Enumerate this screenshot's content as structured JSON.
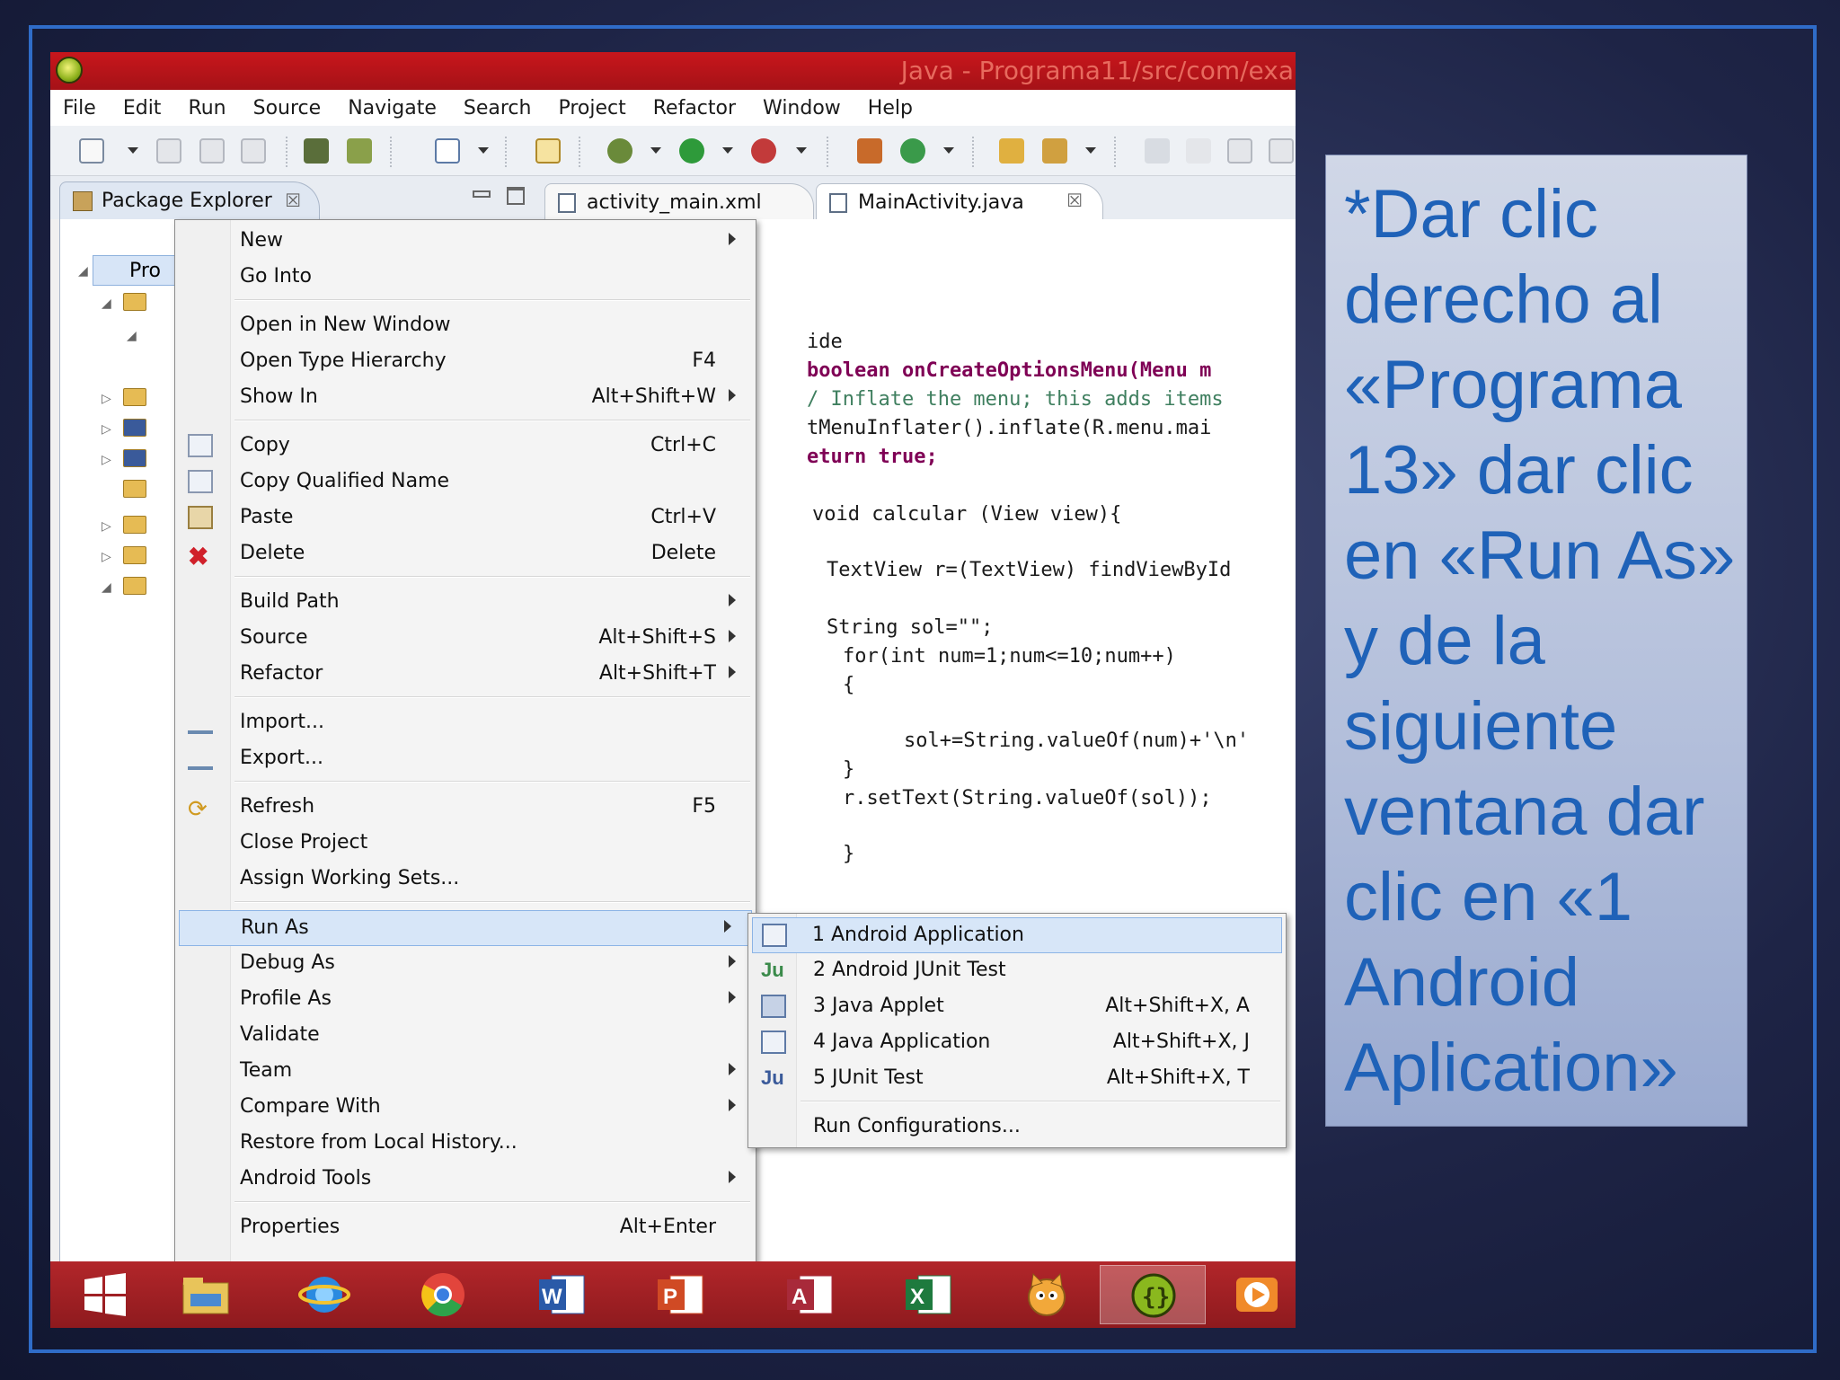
{
  "window": {
    "title": "Java - Programa11/src/com/exa"
  },
  "menubar": [
    "File",
    "Edit",
    "Run",
    "Source",
    "Navigate",
    "Search",
    "Project",
    "Refactor",
    "Window",
    "Help"
  ],
  "views": {
    "package_explorer_label": "Package Explorer",
    "close_glyph": "☒",
    "root_item": "Pro"
  },
  "editor_tabs": [
    {
      "label": "activity_main.xml"
    },
    {
      "label": "MainActivity.java"
    }
  ],
  "code": [
    "ide",
    "boolean onCreateOptionsMenu(Menu m",
    "/ Inflate the menu; this adds items",
    "tMenuInflater().inflate(R.menu.mai",
    "eturn true;",
    "void calcular (View view){",
    "TextView r=(TextView) findViewById",
    "String sol=\"\";",
    "for(int num=1;num<=10;num++)",
    "{",
    "sol+=String.valueOf(num)+'\\n'",
    "}",
    "r.setText(String.valueOf(sol));",
    "}"
  ],
  "context_menu": {
    "new": "New",
    "go_into": "Go Into",
    "open_new_window": "Open in New Window",
    "open_type_hierarchy": "Open Type Hierarchy",
    "open_type_hierarchy_sc": "F4",
    "show_in": "Show In",
    "show_in_sc": "Alt+Shift+W",
    "copy": "Copy",
    "copy_sc": "Ctrl+C",
    "copy_qualified": "Copy Qualified Name",
    "paste": "Paste",
    "paste_sc": "Ctrl+V",
    "delete": "Delete",
    "delete_sc": "Delete",
    "build_path": "Build Path",
    "source": "Source",
    "source_sc": "Alt+Shift+S",
    "refactor": "Refactor",
    "refactor_sc": "Alt+Shift+T",
    "import": "Import...",
    "export": "Export...",
    "refresh": "Refresh",
    "refresh_sc": "F5",
    "close_project": "Close Project",
    "assign_working_sets": "Assign Working Sets...",
    "run_as": "Run As",
    "debug_as": "Debug As",
    "profile_as": "Profile As",
    "validate": "Validate",
    "team": "Team",
    "compare_with": "Compare With",
    "restore_history": "Restore from Local History...",
    "android_tools": "Android Tools",
    "properties": "Properties",
    "properties_sc": "Alt+Enter"
  },
  "run_as_menu": {
    "android_app": "1 Android Application",
    "android_junit": "2 Android JUnit Test",
    "java_applet": "3 Java Applet",
    "java_applet_sc": "Alt+Shift+X, A",
    "java_app": "4 Java Application",
    "java_app_sc": "Alt+Shift+X, J",
    "junit": "5 JUnit Test",
    "junit_sc": "Alt+Shift+X, T",
    "run_configs": "Run Configurations..."
  },
  "taskbar": [
    "windows-logo-icon",
    "file-explorer-icon",
    "internet-explorer-icon",
    "chrome-icon",
    "word-icon",
    "powerpoint-icon",
    "access-icon",
    "excel-icon",
    "scratch-icon",
    "eclipse-icon",
    "media-player-icon"
  ],
  "instruction": "*Dar clic derecho al «Programa 13» dar clic en «Run As» y de la siguiente ventana dar clic en «1 Android Aplication»",
  "colors": {
    "frame": "#2f6cc8",
    "titlebar": "#c8161c",
    "instruction_text": "#1f62b8",
    "highlight": "#d7e6f8"
  }
}
